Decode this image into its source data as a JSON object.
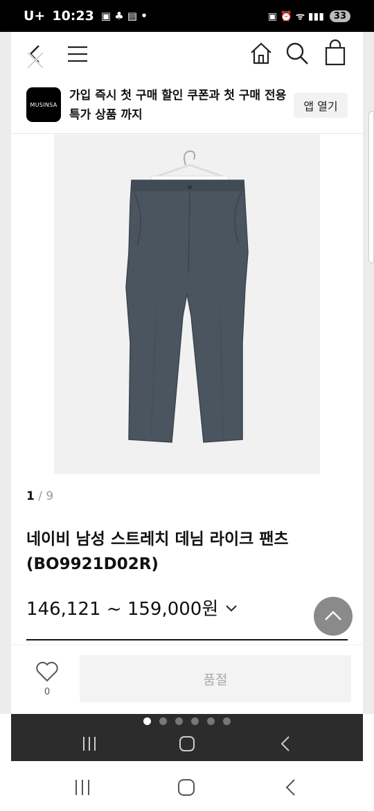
{
  "status_bar": {
    "carrier": "U+",
    "time": "10:23",
    "battery": "33"
  },
  "header": {
    "icons": [
      "close-icon",
      "back-icon",
      "menu-icon",
      "home-icon",
      "search-icon",
      "cart-icon"
    ]
  },
  "promo": {
    "logo_text": "MUSINSA",
    "text": "가입 즉시 첫 구매 할인 쿠폰과 첫 구매 전용 특가 상품 까지",
    "button_label": "앱 열기"
  },
  "gallery": {
    "current": "1",
    "separator": "/",
    "total": "9"
  },
  "product": {
    "title": "네이비 남성 스트레치 데님 라이크 팬츠 (BO9921D02R)",
    "price": "146,121 ~ 159,000원"
  },
  "action_bar": {
    "like_count": "0",
    "soldout_label": "품절"
  },
  "colors": {
    "pants": "#4a5560",
    "image_bg": "#f1f1f1",
    "soldout_bg": "#f3f3f3",
    "scroll_top_bg": "#8a8a8a"
  }
}
